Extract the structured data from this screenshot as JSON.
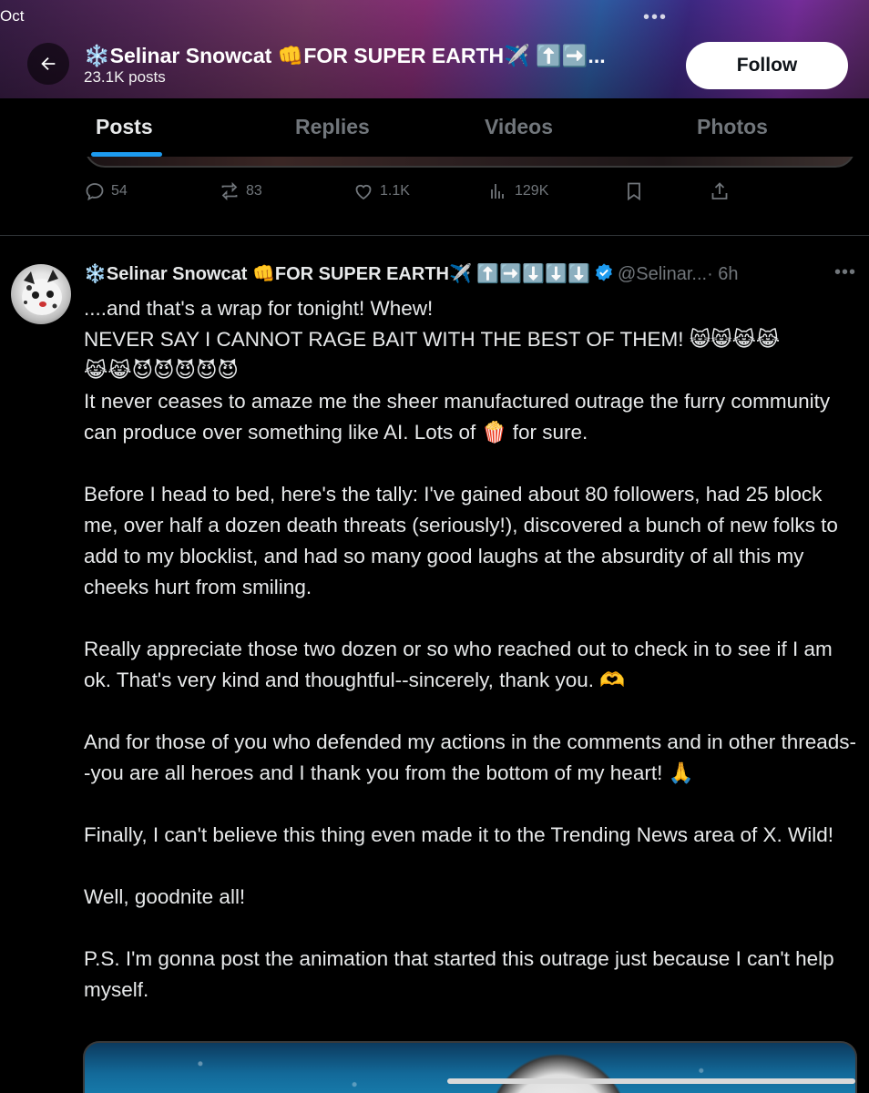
{
  "status": {
    "time": "Oct",
    "dots": "•••"
  },
  "header": {
    "name": "❄️Selinar Snowcat 👊FOR SUPER EARTH✈️ ⬆️➡️...",
    "posts_count": "23.1K posts",
    "follow_label": "Follow"
  },
  "tabs": [
    "Posts",
    "Replies",
    "Videos",
    "Photos"
  ],
  "previous_post": {
    "replies": "54",
    "reposts": "83",
    "likes": "1.1K",
    "views": "129K"
  },
  "post": {
    "name": "❄️Selinar Snowcat 👊FOR SUPER EARTH✈️ ⬆️➡️⬇️⬇️⬇️",
    "handle": "@Selinar...",
    "time": "· 6h",
    "more": "•••",
    "body": "....and that's a wrap for tonight! Whew!\nNEVER SAY I CANNOT RAGE BAIT WITH THE BEST OF THEM! 😸😸😹😹\n😹😹😈😈😈😈😈\nIt never ceases to amaze me the sheer manufactured outrage the furry community can produce over something like AI. Lots of 🍿 for sure.\n\nBefore I head to bed, here's the tally: I've gained about 80 followers, had 25 block me, over half a dozen death threats (seriously!), discovered a bunch of new folks to add to my blocklist, and had so many good laughs at the absurdity of all this my cheeks hurt from smiling.\n\nReally appreciate those two dozen or so who reached out to check in to see if I am ok. That's very kind and thoughtful--sincerely, thank you. 🫶\n\nAnd for those of you who defended my actions in the comments and in other threads--you are all heroes and I thank you from the bottom of my heart! 🙏\n\nFinally, I can't believe this thing even made it to the Trending News area of X. Wild!\n\nWell, goodnite all!\n\nP.S. I'm gonna post the animation that started this outrage just because I can't help myself."
  },
  "colors": {
    "accent": "#1d9bf0",
    "muted": "#71767b",
    "text": "#e7e9ea",
    "background": "#000000"
  }
}
